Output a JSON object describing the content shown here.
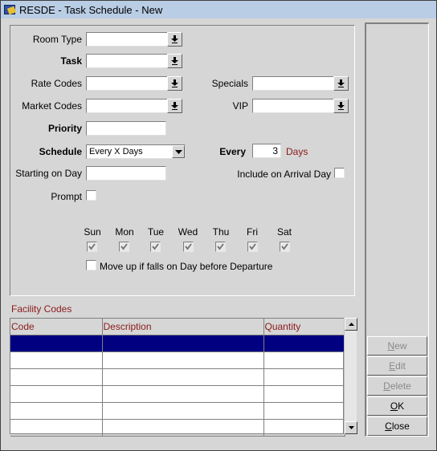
{
  "window": {
    "title": "RESDE - Task Schedule - New"
  },
  "form": {
    "room_type": {
      "label": "Room Type",
      "value": ""
    },
    "task": {
      "label": "Task",
      "value": ""
    },
    "rate_codes": {
      "label": "Rate Codes",
      "value": ""
    },
    "market_codes": {
      "label": "Market Codes",
      "value": ""
    },
    "specials": {
      "label": "Specials",
      "value": ""
    },
    "vip": {
      "label": "VIP",
      "value": ""
    },
    "priority": {
      "label": "Priority",
      "value": ""
    },
    "schedule": {
      "label": "Schedule",
      "value": "Every X Days"
    },
    "every": {
      "label": "Every",
      "value": "3",
      "unit": "Days"
    },
    "starting_on_day": {
      "label": "Starting on Day",
      "value": ""
    },
    "include_on_arrival_day": {
      "label": "Include on Arrival Day",
      "checked": false
    },
    "prompt": {
      "label": "Prompt",
      "checked": false
    },
    "days": [
      {
        "label": "Sun",
        "checked": true
      },
      {
        "label": "Mon",
        "checked": true
      },
      {
        "label": "Tue",
        "checked": true
      },
      {
        "label": "Wed",
        "checked": true
      },
      {
        "label": "Thu",
        "checked": true
      },
      {
        "label": "Fri",
        "checked": true
      },
      {
        "label": "Sat",
        "checked": true
      }
    ],
    "move_up": {
      "label": "Move up if falls on Day before Departure",
      "checked": false
    }
  },
  "facility_codes": {
    "title": "Facility Codes",
    "columns": [
      "Code",
      "Description",
      "Quantity"
    ],
    "rows": [
      [
        "",
        "",
        ""
      ],
      [
        "",
        "",
        ""
      ],
      [
        "",
        "",
        ""
      ],
      [
        "",
        "",
        ""
      ],
      [
        "",
        "",
        ""
      ],
      [
        "",
        "",
        ""
      ]
    ],
    "selected_row": 0
  },
  "buttons": {
    "new": {
      "mnemonic": "N",
      "rest": "ew",
      "enabled": false
    },
    "edit": {
      "mnemonic": "E",
      "rest": "dit",
      "enabled": false
    },
    "delete": {
      "mnemonic": "D",
      "rest": "elete",
      "enabled": false
    },
    "ok": {
      "mnemonic": "O",
      "rest": "K",
      "enabled": true
    },
    "close": {
      "mnemonic": "C",
      "rest": "lose",
      "enabled": true
    }
  },
  "colors": {
    "titlebar": "#b9cde5",
    "accent_red": "#8b1a1a",
    "selection": "#000080"
  }
}
